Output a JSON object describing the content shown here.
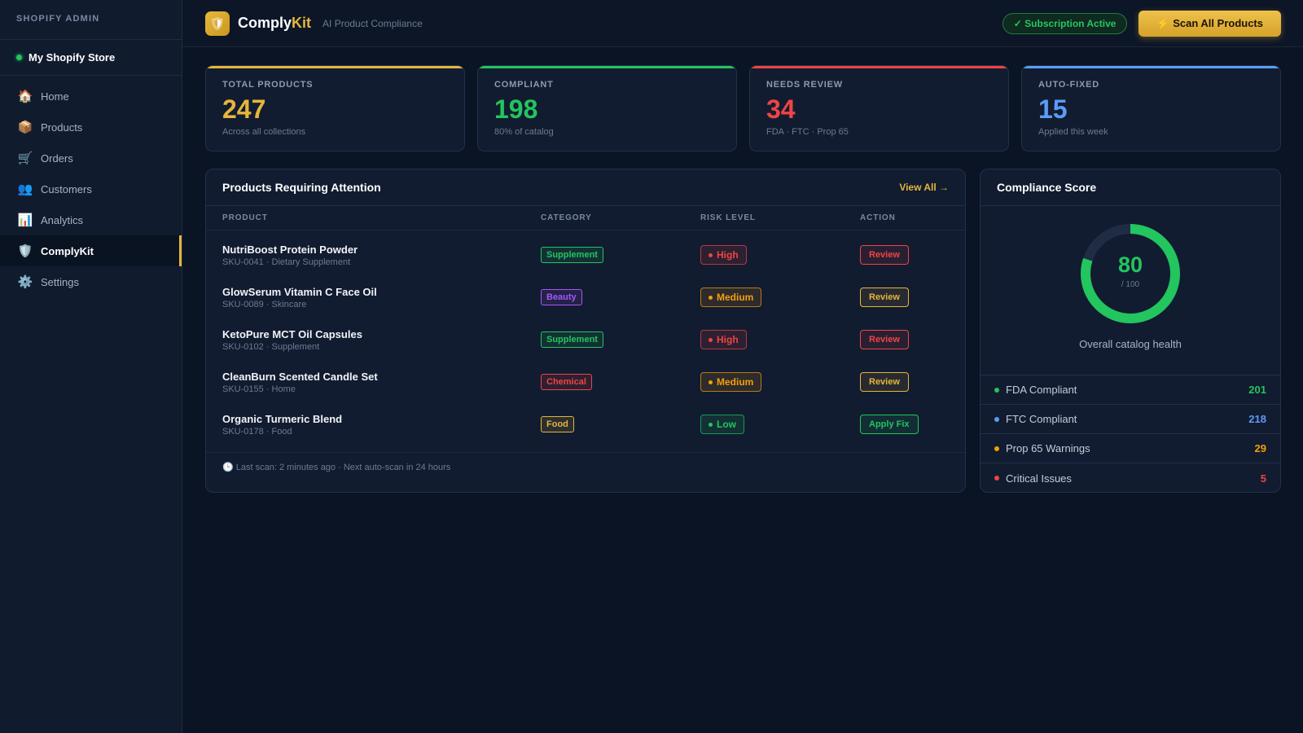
{
  "sidebar": {
    "admin_label": "SHOPIFY ADMIN",
    "store_name": "My Shopify Store",
    "items": [
      {
        "label": "Home",
        "icon": "🏠"
      },
      {
        "label": "Products",
        "icon": "📦"
      },
      {
        "label": "Orders",
        "icon": "🛒"
      },
      {
        "label": "Customers",
        "icon": "👥"
      },
      {
        "label": "Analytics",
        "icon": "📊"
      },
      {
        "label": "ComplyKit",
        "icon": "🛡️",
        "active": true
      },
      {
        "label": "Settings",
        "icon": "⚙️"
      }
    ]
  },
  "header": {
    "logo_icon": "🛡",
    "brand_part1": "Comply",
    "brand_part2": "Kit",
    "subtitle": "AI Product Compliance",
    "subscription_badge": "✓ Subscription Active",
    "scan_button": "⚡ Scan All Products"
  },
  "stats": [
    {
      "label": "TOTAL PRODUCTS",
      "value": "247",
      "sub": "Across all collections",
      "accent": "#e6b53a"
    },
    {
      "label": "COMPLIANT",
      "value": "198",
      "sub": "80% of catalog",
      "accent": "#22c55e"
    },
    {
      "label": "NEEDS REVIEW",
      "value": "34",
      "sub": "FDA · FTC · Prop 65",
      "accent": "#ef4444"
    },
    {
      "label": "AUTO-FIXED",
      "value": "15",
      "sub": "Applied this week",
      "accent": "#5b9cf6"
    }
  ],
  "products_panel": {
    "title": "Products Requiring Attention",
    "view_all": "View All →",
    "columns": [
      "PRODUCT",
      "CATEGORY",
      "RISK LEVEL",
      "ACTION"
    ],
    "rows": [
      {
        "name": "NutriBoost Protein Powder",
        "sku": "SKU-0041 · Dietary Supplement",
        "category": "Supplement",
        "risk": "High",
        "action": "Review"
      },
      {
        "name": "GlowSerum Vitamin C Face Oil",
        "sku": "SKU-0089 · Skincare",
        "category": "Beauty",
        "risk": "Medium",
        "action": "Review"
      },
      {
        "name": "KetoPure MCT Oil Capsules",
        "sku": "SKU-0102 · Supplement",
        "category": "Supplement",
        "risk": "High",
        "action": "Review"
      },
      {
        "name": "CleanBurn Scented Candle Set",
        "sku": "SKU-0155 · Home",
        "category": "Chemical",
        "risk": "Medium",
        "action": "Review"
      },
      {
        "name": "Organic Turmeric Blend",
        "sku": "SKU-0178 · Food",
        "category": "Food",
        "risk": "Low",
        "action": "Apply Fix"
      }
    ],
    "footer": "🕒 Last scan: 2 minutes ago · Next auto-scan in 24 hours"
  },
  "score_panel": {
    "title": "Compliance Score",
    "score": "80",
    "score_fraction": 0.8,
    "denominator": "/ 100",
    "caption": "Overall catalog health",
    "metrics": [
      {
        "label": "FDA Compliant",
        "value": "201",
        "color": "#22c55e"
      },
      {
        "label": "FTC Compliant",
        "value": "218",
        "color": "#5b9cf6"
      },
      {
        "label": "Prop 65 Warnings",
        "value": "29",
        "color": "#f59e0b"
      },
      {
        "label": "Critical Issues",
        "value": "5",
        "color": "#ef4444"
      }
    ]
  },
  "colors": {
    "gold": "#e6b53a",
    "green": "#22c55e",
    "red": "#ef4444",
    "orange": "#f59e0b",
    "purple": "#a855f7",
    "blue": "#5b9cf6"
  }
}
